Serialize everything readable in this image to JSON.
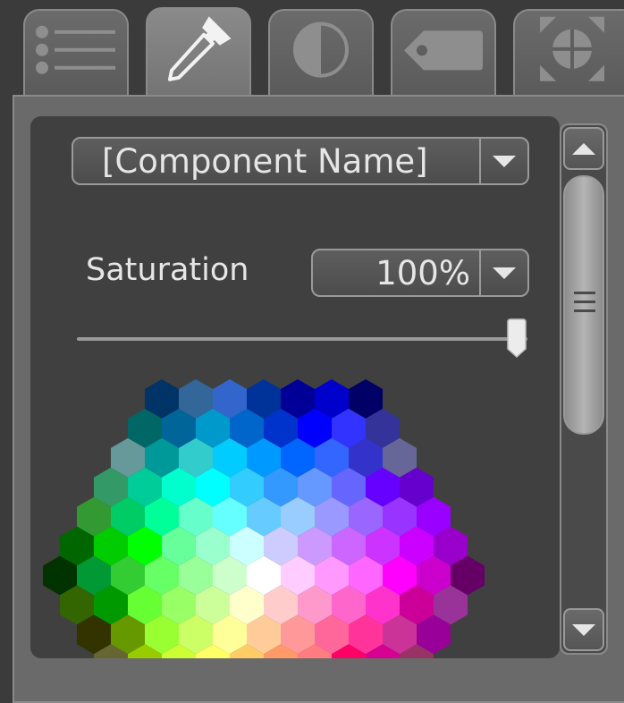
{
  "tabs": [
    {
      "name": "list",
      "icon": "list-icon",
      "active": false
    },
    {
      "name": "color",
      "icon": "eyedropper-icon",
      "active": true
    },
    {
      "name": "contrast",
      "icon": "contrast-icon",
      "active": false
    },
    {
      "name": "tag",
      "icon": "tag-icon",
      "active": false
    },
    {
      "name": "transform",
      "icon": "move-icon",
      "active": false
    }
  ],
  "component_dropdown": {
    "value": "[Component Name]"
  },
  "saturation": {
    "label": "Saturation",
    "value": "100%",
    "level": 1.0
  },
  "scrollbar": {
    "up": "scroll-up",
    "down": "scroll-down"
  },
  "colors": {
    "grid_rows": [
      [
        "#003366",
        "#336699",
        "#3366cc",
        "#003399",
        "#000099",
        "#0000cc",
        "#000066"
      ],
      [
        "#006666",
        "#006699",
        "#0099cc",
        "#0066cc",
        "#0033cc",
        "#0000ff",
        "#3333ff",
        "#333399"
      ],
      [
        "#669999",
        "#009999",
        "#33cccc",
        "#00ccff",
        "#0099ff",
        "#0066ff",
        "#3366ff",
        "#3333cc",
        "#666699"
      ],
      [
        "#339966",
        "#00cc99",
        "#00ffcc",
        "#00ffff",
        "#33ccff",
        "#3399ff",
        "#6699ff",
        "#6666ff",
        "#6600ff",
        "#6600cc"
      ],
      [
        "#339933",
        "#00cc66",
        "#00ff99",
        "#66ffcc",
        "#66ffff",
        "#66ccff",
        "#99ccff",
        "#9999ff",
        "#9966ff",
        "#9933ff",
        "#9900ff"
      ],
      [
        "#006600",
        "#00cc00",
        "#00ff00",
        "#66ff99",
        "#99ffcc",
        "#ccffff",
        "#ccccff",
        "#cc99ff",
        "#cc66ff",
        "#cc33ff",
        "#cc00ff",
        "#9900cc"
      ],
      [
        "#003300",
        "#009933",
        "#33cc33",
        "#66ff66",
        "#99ff99",
        "#ccffcc",
        "#ffffff",
        "#ffccff",
        "#ff99ff",
        "#ff66ff",
        "#ff00ff",
        "#cc00cc",
        "#660066"
      ],
      [
        "#336600",
        "#009900",
        "#66ff33",
        "#99ff66",
        "#ccff99",
        "#ffffcc",
        "#ffcccc",
        "#ff99cc",
        "#ff66cc",
        "#ff33cc",
        "#cc0099",
        "#993399"
      ],
      [
        "#333300",
        "#669900",
        "#99ff33",
        "#ccff66",
        "#ffff99",
        "#ffcc99",
        "#ff9999",
        "#ff6699",
        "#ff3399",
        "#cc3399",
        "#990099"
      ],
      [
        "#666633",
        "#99cc00",
        "#ccff33",
        "#ffff66",
        "#ffcc66",
        "#ff9966",
        "#ff7c80",
        "#ff0066",
        "#d60093",
        "#993366"
      ]
    ]
  }
}
